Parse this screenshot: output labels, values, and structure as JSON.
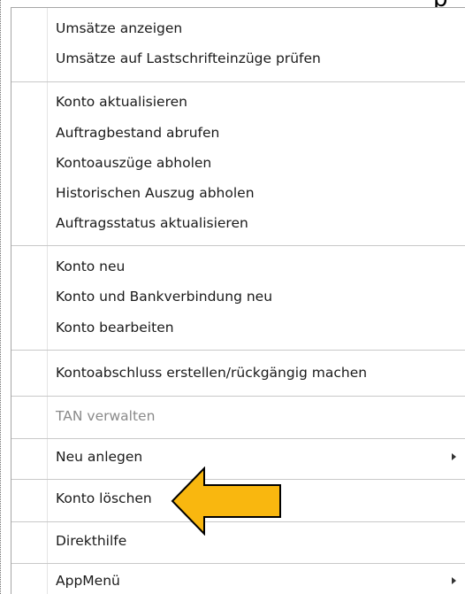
{
  "menu": {
    "items": [
      {
        "label": "Umsätze anzeigen"
      },
      {
        "label": "Umsätze auf Lastschrifteinzüge prüfen"
      },
      {
        "label": "Konto aktualisieren"
      },
      {
        "label": "Auftragbestand abrufen"
      },
      {
        "label": "Kontoauszüge abholen"
      },
      {
        "label": "Historischen Auszug abholen"
      },
      {
        "label": "Auftragsstatus aktualisieren"
      },
      {
        "label": "Konto neu"
      },
      {
        "label": "Konto und Bankverbindung neu"
      },
      {
        "label": "Konto bearbeiten"
      },
      {
        "label": "Kontoabschluss erstellen/rückgängig machen"
      },
      {
        "label": "TAN verwalten",
        "disabled": true
      },
      {
        "label": "Neu anlegen",
        "submenu": true
      },
      {
        "label": "Konto löschen",
        "highlighted_by_arrow": true
      },
      {
        "label": "Direkthilfe"
      },
      {
        "label": "AppMenü",
        "submenu": true
      }
    ]
  },
  "background": {
    "partial_glyph": "p"
  },
  "colors": {
    "arrow_fill": "#f9b70f",
    "arrow_stroke": "#000000",
    "separator": "#c8c8c8",
    "disabled_text": "#8a8a8a"
  },
  "icons": {
    "submenu": "chevron-right-icon",
    "callout": "arrow-left-icon"
  }
}
